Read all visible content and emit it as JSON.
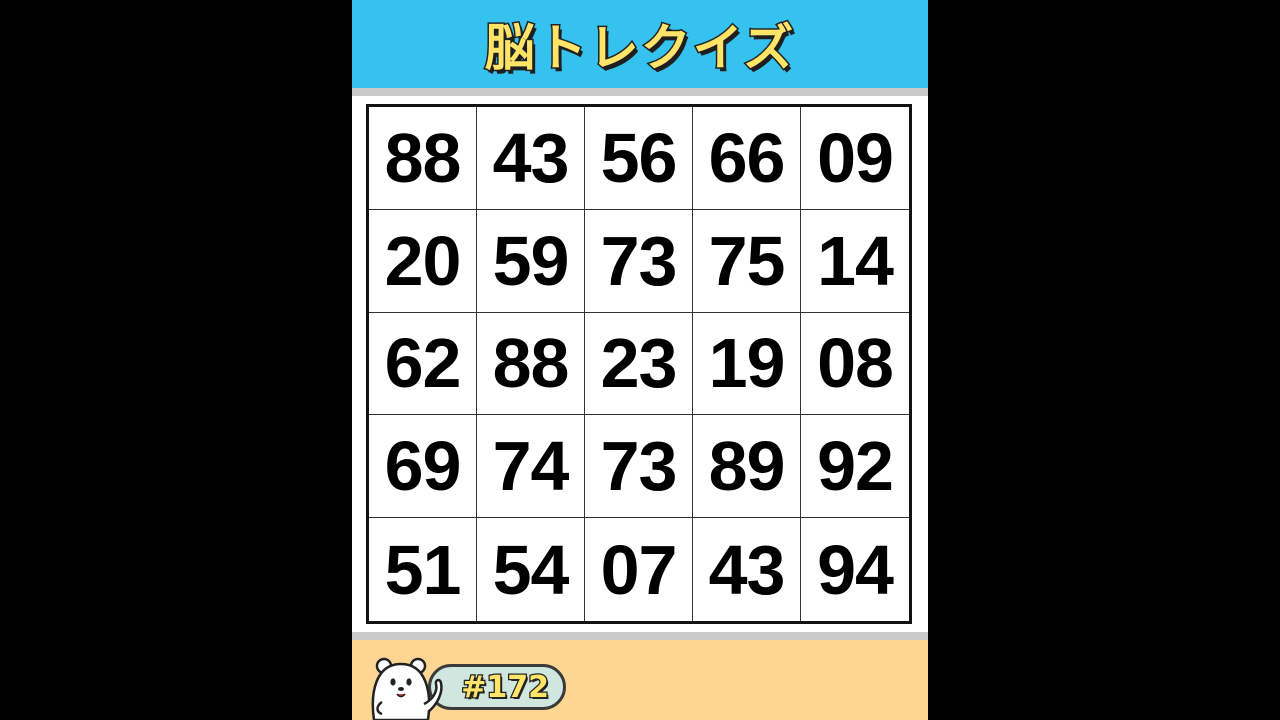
{
  "header": {
    "title": "脳トレクイズ"
  },
  "puzzle": {
    "rows": [
      [
        "88",
        "43",
        "56",
        "66",
        "09"
      ],
      [
        "20",
        "59",
        "73",
        "75",
        "14"
      ],
      [
        "62",
        "88",
        "23",
        "19",
        "08"
      ],
      [
        "69",
        "74",
        "73",
        "89",
        "92"
      ],
      [
        "51",
        "54",
        "07",
        "43",
        "94"
      ]
    ]
  },
  "footer": {
    "episode": "#172",
    "mascot_icon": "white-bear-mascot-icon"
  },
  "colors": {
    "header_bg": "#35c2ee",
    "title_fill": "#ffe468",
    "footer_bg": "#ffd592",
    "badge_bg": "#cfe7de",
    "letterbox": "#000000"
  }
}
